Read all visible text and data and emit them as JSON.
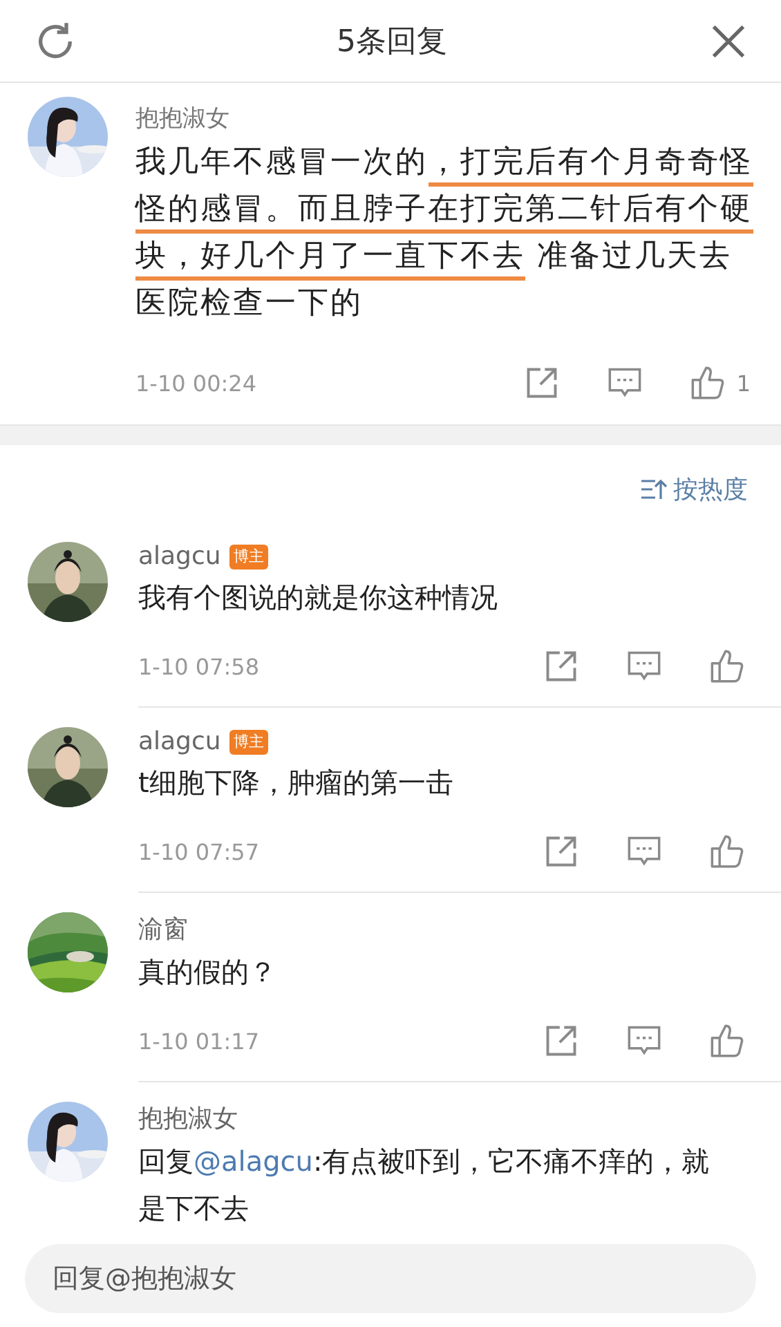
{
  "header": {
    "title": "5条回复"
  },
  "post": {
    "author": "抱抱淑女",
    "segments": [
      {
        "text": "我几年不感冒一次的",
        "underlined": false
      },
      {
        "text": "，打完后有个月奇奇怪怪的感冒。而且脖子在打完第二针后有个硬块，好几个月了一直下不去",
        "underlined": true
      },
      {
        "text": " 准备过几天去医院检查一下的",
        "underlined": false
      }
    ],
    "time": "1-10 00:24",
    "likes": "1"
  },
  "sort": {
    "label": "按热度"
  },
  "comments": [
    {
      "author": "alagcu",
      "badge": "博主",
      "text": "我有个图说的就是你这种情况",
      "time": "1-10 07:58"
    },
    {
      "author": "alagcu",
      "badge": "博主",
      "text": "t细胞下降，肿瘤的第一击",
      "time": "1-10 07:57"
    },
    {
      "author": "渝窗",
      "text": "真的假的？",
      "time": "1-10 01:17"
    },
    {
      "author": "抱抱淑女",
      "reply_prefix": "回复",
      "mention": "@alagcu",
      "text": ":有点被吓到，它不痛不痒的，就是下不去"
    }
  ],
  "reply_field": {
    "placeholder": "回复@抱抱淑女"
  }
}
